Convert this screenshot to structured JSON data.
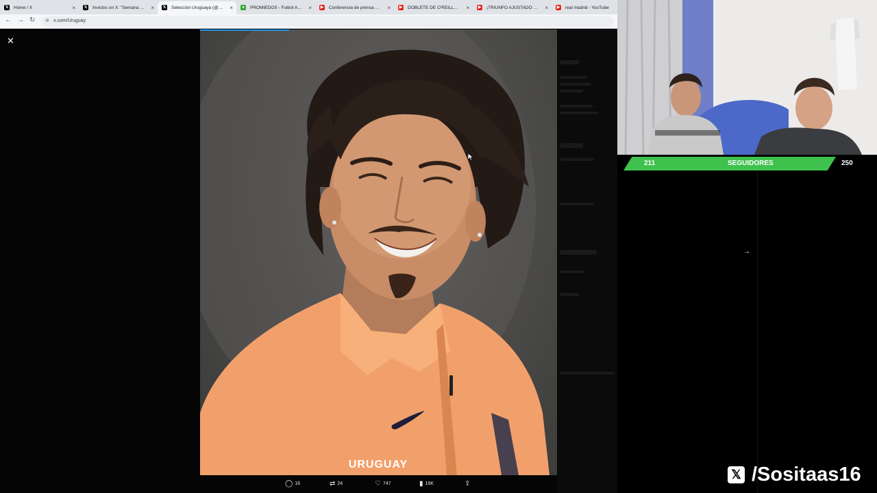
{
  "browser": {
    "tabs": [
      {
        "title": "Home / X",
        "icon": "x-logo-icon",
        "color": "#000000",
        "active": false
      },
      {
        "title": "Invictos on X: \"Semana de fe",
        "icon": "x-logo-icon",
        "color": "#000000",
        "active": false
      },
      {
        "title": "Selección Uruguaya (@Urugu",
        "icon": "x-logo-icon",
        "color": "#000000",
        "active": true
      },
      {
        "title": "PROMIEDOS - Futbol Argenti",
        "icon": "promiedos-icon",
        "color": "#3aa53a",
        "active": false
      },
      {
        "title": "Conferencia de prensa Jos",
        "icon": "youtube-icon",
        "color": "#e62117",
        "active": false
      },
      {
        "title": "DOBLETE DE O'REILLY EN 4 M",
        "icon": "youtube-icon",
        "color": "#e62117",
        "active": false
      },
      {
        "title": "¡TRIUNFO AJUSTADO de #EA",
        "icon": "youtube-icon",
        "color": "#e62117",
        "active": false
      },
      {
        "title": "real madrid - YouTube",
        "icon": "youtube-icon",
        "color": "#e62117",
        "active": false
      }
    ],
    "url": "x.com/Uruguay"
  },
  "viewer": {
    "watermark": "URUGUAY",
    "progress_fraction": 0.25,
    "actions": {
      "replies": "16",
      "reposts": "24",
      "likes": "747",
      "views": "16K"
    }
  },
  "stream": {
    "followers_current": "211",
    "followers_label": "SEGUIDORES",
    "followers_goal": "250",
    "followers_fraction": 0.844,
    "handle": "/Sositaas16",
    "bar_color": "#3fc24d"
  }
}
